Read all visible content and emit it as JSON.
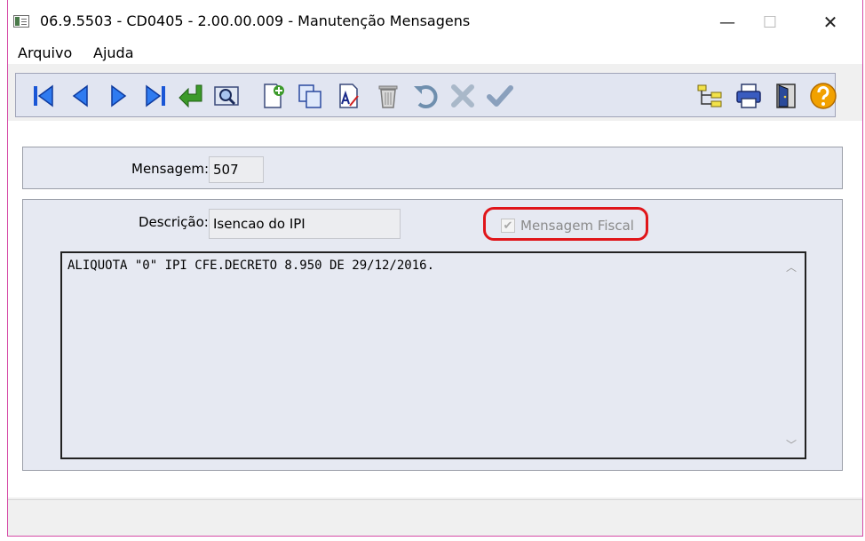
{
  "window": {
    "title": "06.9.5503 - CD0405 - 2.00.00.009 - Manutenção Mensagens",
    "minimize_glyph": "—",
    "maximize_glyph": "☐",
    "close_glyph": "✕"
  },
  "menu": [
    {
      "label": "Arquivo"
    },
    {
      "label": "Ajuda"
    }
  ],
  "toolbar": {
    "icons": [
      "first-record-icon",
      "previous-record-icon",
      "next-record-icon",
      "last-record-icon",
      "goto-icon",
      "search-icon",
      "new-icon",
      "copy-icon",
      "edit-icon",
      "delete-icon",
      "undo-icon",
      "cancel-icon",
      "confirm-icon",
      "tree-icon",
      "print-icon",
      "exit-icon",
      "help-icon"
    ],
    "colors": {
      "nav_blue": "#1a56d6",
      "green": "#3c9a2a",
      "help_orange": "#f2a100"
    }
  },
  "form": {
    "mensagem_label": "Mensagem:",
    "mensagem_value": "507",
    "descricao_label": "Descrição:",
    "descricao_value": "Isencao do IPI",
    "fiscal_label": "Mensagem Fiscal",
    "fiscal_checked": true,
    "text": "ALIQUOTA \"0\" IPI CFE.DECRETO 8.950 DE 29/12/2016."
  },
  "highlight_color": "#e0151a"
}
